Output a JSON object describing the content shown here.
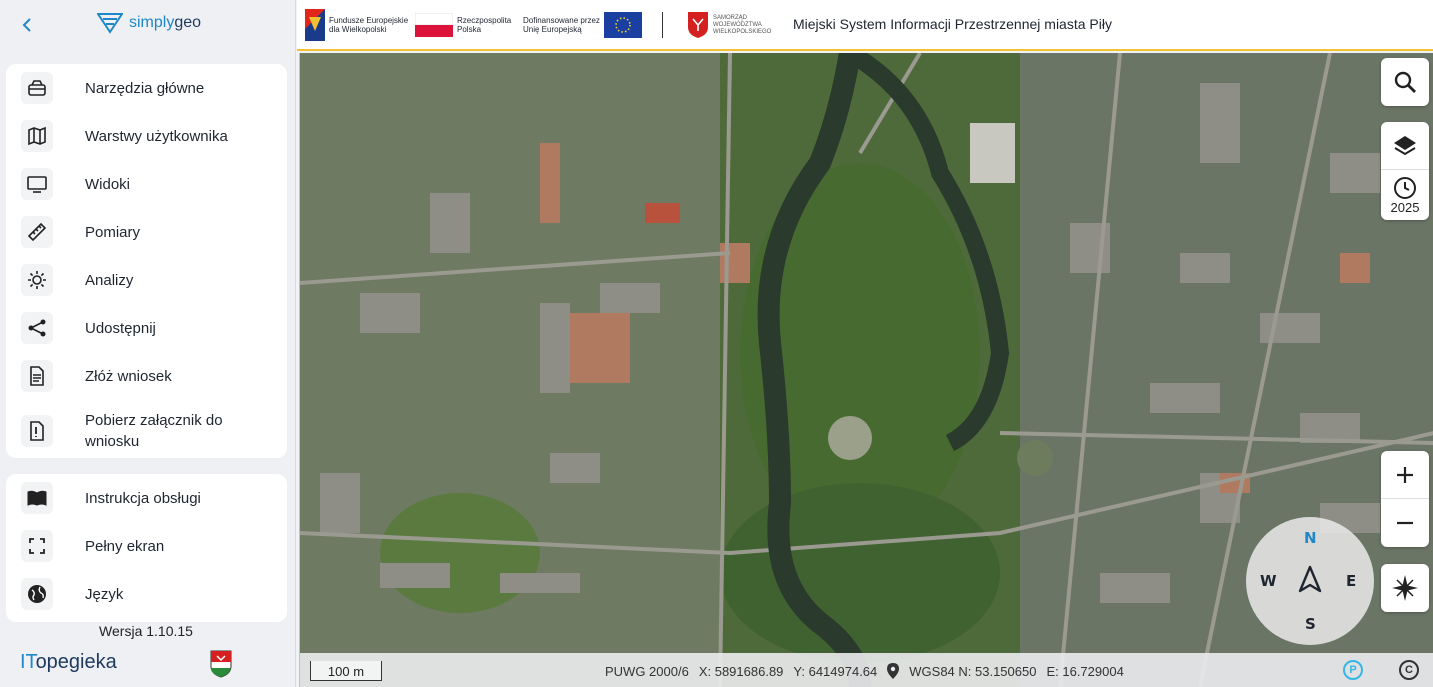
{
  "header": {
    "back_icon": "chevron-left-icon",
    "logo_text_light": "simply",
    "logo_text_bold": "geo",
    "partners": [
      {
        "line1": "Fundusze Europejskie",
        "line2": "dla Wielkopolski"
      },
      {
        "line1": "Rzeczpospolita",
        "line2": "Polska"
      },
      {
        "line1": "Dofinansowane przez",
        "line2": "Unię Europejską"
      },
      {
        "line1": "SAMORZĄD",
        "line2": "WOJEWÓDZTWA",
        "line3": "WIELKOPOLSKIEGO"
      }
    ],
    "title": "Miejski System Informacji Przestrzennej miasta Piły"
  },
  "sidebar": {
    "main_items": [
      {
        "label": "Narzędzia główne",
        "icon": "toolbox-icon"
      },
      {
        "label": "Warstwy użytkownika",
        "icon": "map-icon"
      },
      {
        "label": "Widoki",
        "icon": "monitor-icon"
      },
      {
        "label": "Pomiary",
        "icon": "ruler-icon"
      },
      {
        "label": "Analizy",
        "icon": "analysis-icon"
      },
      {
        "label": "Udostępnij",
        "icon": "share-icon"
      },
      {
        "label": "Złóż wniosek",
        "icon": "document-icon"
      },
      {
        "label": "Pobierz załącznik do wniosku",
        "icon": "attachment-icon"
      }
    ],
    "extra_items": [
      {
        "label": "Instrukcja obsługi",
        "icon": "book-icon"
      },
      {
        "label": "Pełny ekran",
        "icon": "fullscreen-icon"
      },
      {
        "label": "Język",
        "icon": "globe-icon"
      }
    ],
    "version": "Wersja 1.10.15",
    "footer_logo_it": "IT",
    "footer_logo_rest": "opegieka"
  },
  "map": {
    "year_label": "2025",
    "compass": {
      "n": "N",
      "s": "S",
      "e": "E",
      "w": "W"
    },
    "scale_label": "100 m",
    "coord_system": "PUWG 2000/6",
    "x_label": "X: 5891686.89",
    "y_label": "Y: 6414974.64",
    "wgs_label": "WGS84 N: 53.150650",
    "e_label": "E: 16.729004",
    "p_label": "P",
    "copy_label": "C"
  },
  "colors": {
    "accent": "#1e88c8",
    "header_border": "#f2c232",
    "river": "#2a3a2c"
  }
}
